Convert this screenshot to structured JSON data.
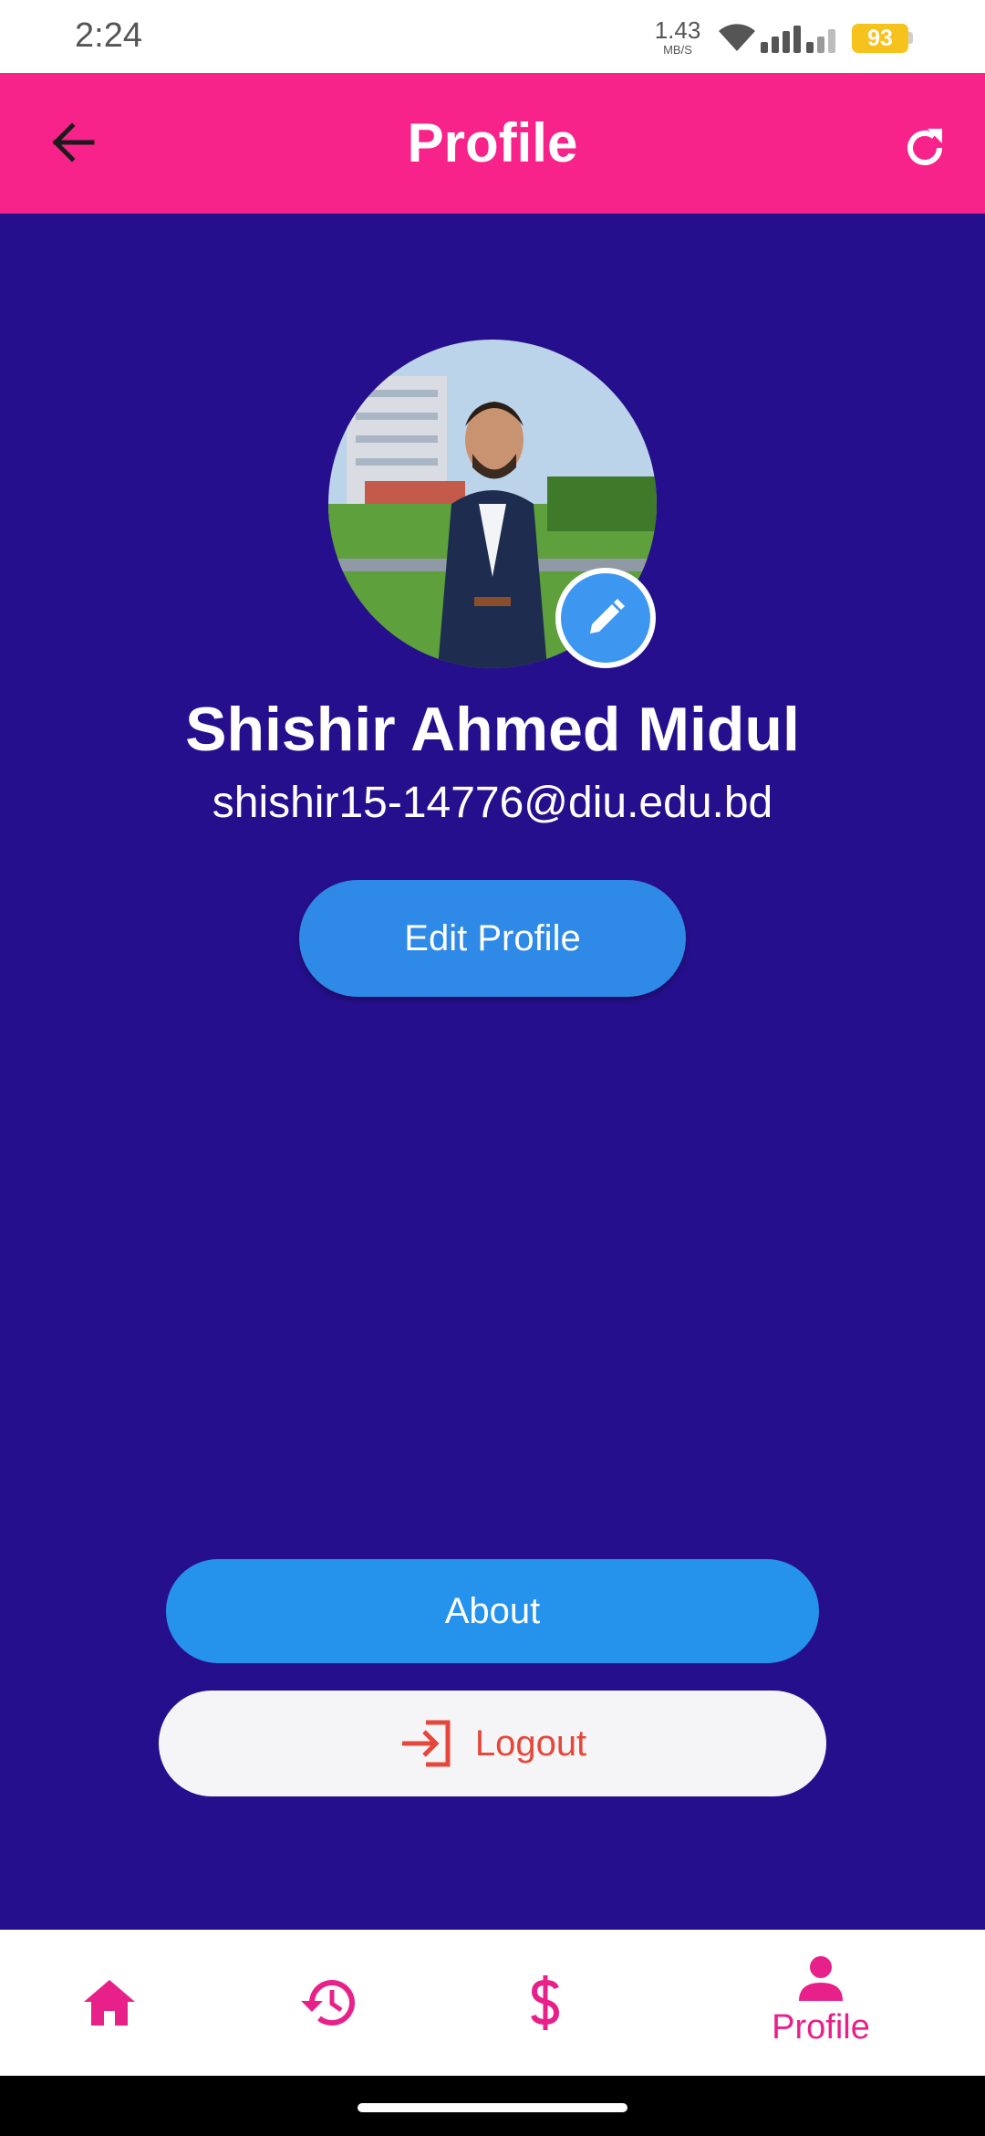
{
  "status_bar": {
    "time": "2:24",
    "net_speed": "1.43",
    "net_unit": "MB/S",
    "battery": "93"
  },
  "app_bar": {
    "title": "Profile",
    "back_icon": "arrow-left-icon",
    "refresh_icon": "refresh-icon"
  },
  "profile": {
    "name": "Shishir Ahmed Midul",
    "email": "shishir15-14776@diu.edu.bd",
    "edit_profile_label": "Edit Profile",
    "avatar_edit_icon": "pencil-icon"
  },
  "actions": {
    "about_label": "About",
    "logout_label": "Logout",
    "logout_icon": "login-arrow-icon"
  },
  "bottom_nav": {
    "items": [
      {
        "icon": "home-icon",
        "label": ""
      },
      {
        "icon": "history-icon",
        "label": ""
      },
      {
        "icon": "dollar-icon",
        "label": ""
      },
      {
        "icon": "person-icon",
        "label": "Profile"
      }
    ],
    "active_index": 3
  },
  "colors": {
    "status_bar_bg": "#ffffff",
    "app_bar_bg": "#f7238a",
    "page_bg": "#260f8c",
    "primary_button": "#2e8ae6",
    "logout_text": "#e5473b",
    "nav_accent": "#e8208a"
  }
}
